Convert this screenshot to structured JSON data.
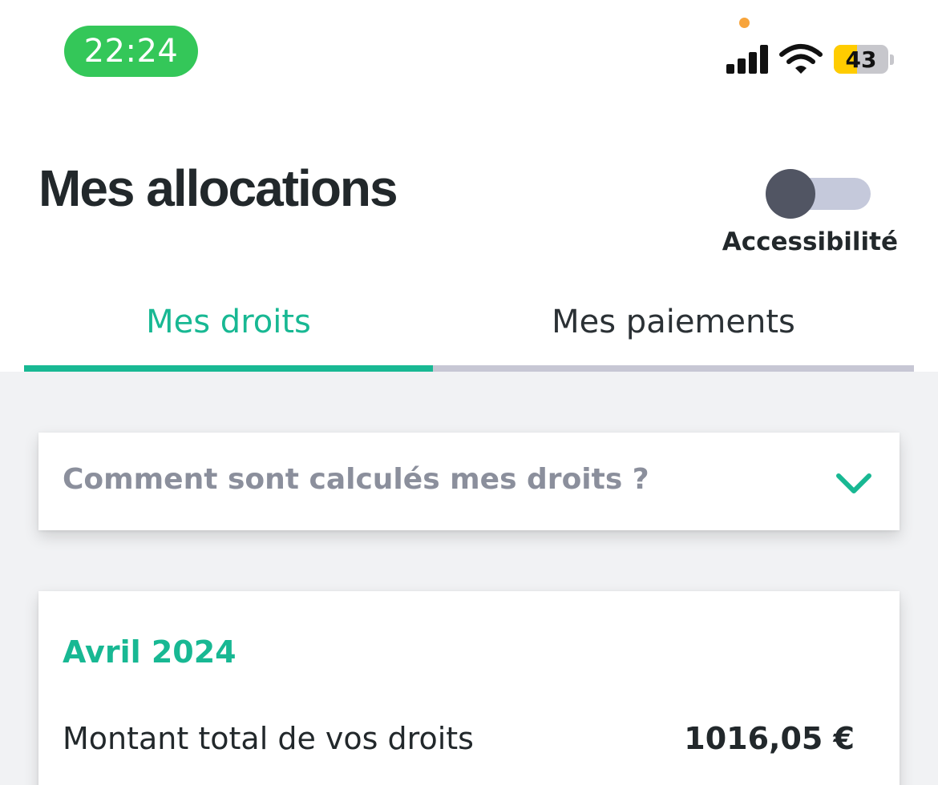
{
  "status_bar": {
    "time": "22:24",
    "battery_level": "43",
    "battery_fraction": 0.43,
    "icons": [
      "signal-icon",
      "wifi-icon",
      "battery-icon"
    ]
  },
  "header": {
    "title": "Mes allocations",
    "accessibility_label": "Accessibilité",
    "accessibility_enabled": false
  },
  "tabs": [
    {
      "label": "Mes droits",
      "active": true
    },
    {
      "label": "Mes paiements",
      "active": false
    }
  ],
  "faq": {
    "question": "Comment sont calculés mes droits ?",
    "icon": "chevron-down-icon"
  },
  "month_card": {
    "month": "Avril 2024",
    "amount_label": "Montant total de vos droits",
    "amount_value": "1016,05 €"
  },
  "colors": {
    "accent": "#18b893",
    "status_green": "#34c759",
    "battery_yellow": "#ffcc00",
    "privacy_dot": "#f7a43b"
  }
}
